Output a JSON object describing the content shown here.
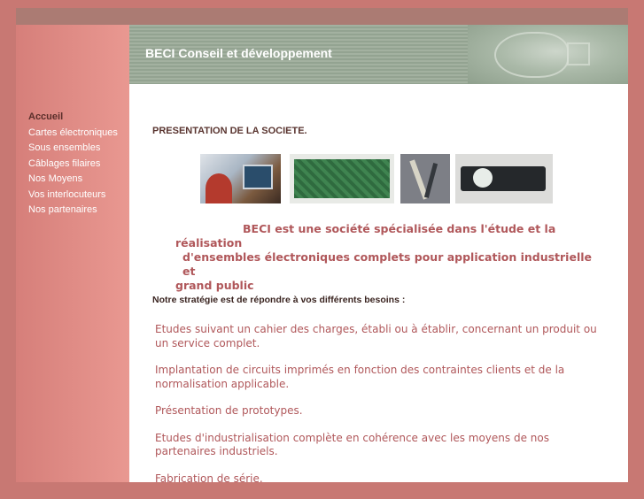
{
  "banner": {
    "title": "BECI  Conseil et développement"
  },
  "nav": {
    "items": [
      "Accueil",
      "Cartes électroniques",
      "Sous ensembles",
      "Câblages filaires",
      "Nos Moyens",
      "Vos interlocuteurs",
      "Nos partenaires"
    ]
  },
  "main": {
    "heading": "PRESENTATION DE LA SOCIETE.",
    "intro_line1": "BECI est une société spécialisée dans l'étude et la",
    "intro_line2": "réalisation",
    "intro_line3": "d'ensembles électroniques complets pour application  industrielle et",
    "intro_line4": "grand public",
    "strategy": "Notre stratégie est de répondre à vos différents besoins :",
    "items": [
      "Etudes suivant un cahier des charges, établi ou à établir, concernant un produit ou un service complet.",
      "Implantation de circuits imprimés en fonction des contraintes clients et de la normalisation applicable.",
      "Présentation de prototypes.",
      "Etudes d'industrialisation complète en cohérence avec les moyens de nos partenaires industriels.",
      "Fabrication de série."
    ]
  },
  "colors": {
    "background": "#c87873",
    "sidebar": "#e08f8a",
    "banner": "#9aab98",
    "accent_text": "#b0575a"
  }
}
